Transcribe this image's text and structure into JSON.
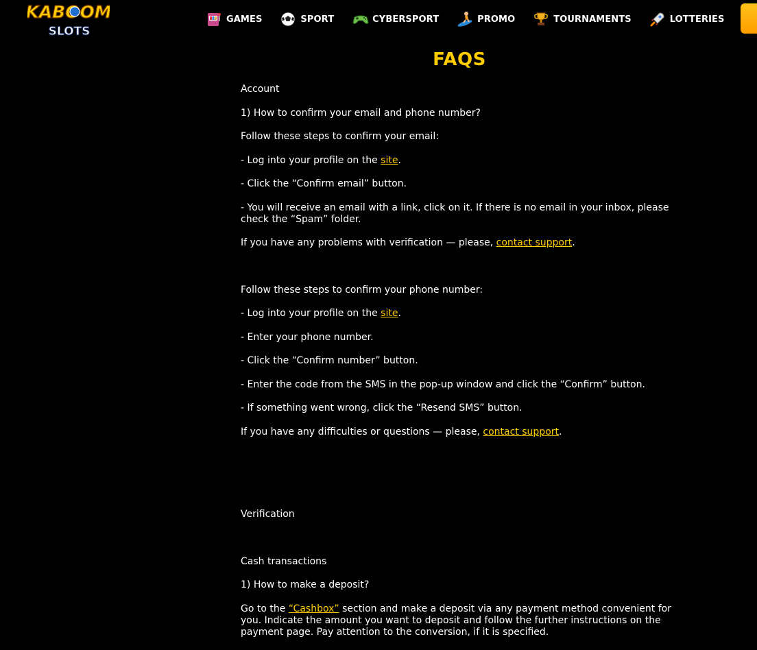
{
  "header": {
    "logo": {
      "line1": "KABOOM",
      "line2": "SLOTS"
    },
    "nav": [
      {
        "label": "GAMES",
        "icon": "slot-machine-icon"
      },
      {
        "label": "SPORT",
        "icon": "soccer-ball-icon"
      },
      {
        "label": "CYBERSPORT",
        "icon": "gamepad-icon"
      },
      {
        "label": "PROMO",
        "icon": "surfer-icon"
      },
      {
        "label": "TOURNAMENTS",
        "icon": "trophy-icon"
      },
      {
        "label": "LOTTERIES",
        "icon": "rocket-icon"
      }
    ],
    "accent_color": "#ffcc00"
  },
  "page": {
    "title": "FAQS",
    "account": {
      "heading": "Account",
      "q1": "1) How to confirm your email and phone number?",
      "email_intro": "Follow these steps to confirm your email:",
      "email_step1_pre": " - Log into your profile on the ",
      "email_step1_link": "site",
      "email_step1_post": ".",
      "email_step2": " - Click the “Confirm email” button.",
      "email_step3": " - You will receive an email with a link, click on it. If there is no email in your inbox, please check the “Spam” folder.",
      "email_support_pre": " If you have any problems with verification — please, ",
      "email_support_link": "contact support",
      "email_support_post": ".",
      "phone_intro": " Follow these steps to confirm your phone number:",
      "phone_step1_pre": " - Log into your profile on the ",
      "phone_step1_link": "site",
      "phone_step1_post": ".",
      "phone_step2": " - Enter your phone number.",
      "phone_step3": " - Click the “Confirm number” button.",
      "phone_step4": " - Enter the code from the SMS in the pop-up window and click the “Confirm” button.",
      "phone_step5": " - If something went wrong, click the “Resend SMS” button.",
      "phone_support_pre": " If you have any difficulties or questions — please, ",
      "phone_support_link": "contact support",
      "phone_support_post": "."
    },
    "verification": {
      "heading": "Verification"
    },
    "cash": {
      "heading": "Cash transactions",
      "q1": "1) How to make a deposit?",
      "answer_pre": "Go to the ",
      "answer_link": "“Cashbox”",
      "answer_post": " section and make a deposit via any payment method convenient for you. Indicate the amount you want to deposit and follow the further instructions on the payment page. Pay attention to the conversion, if it is specified."
    }
  }
}
